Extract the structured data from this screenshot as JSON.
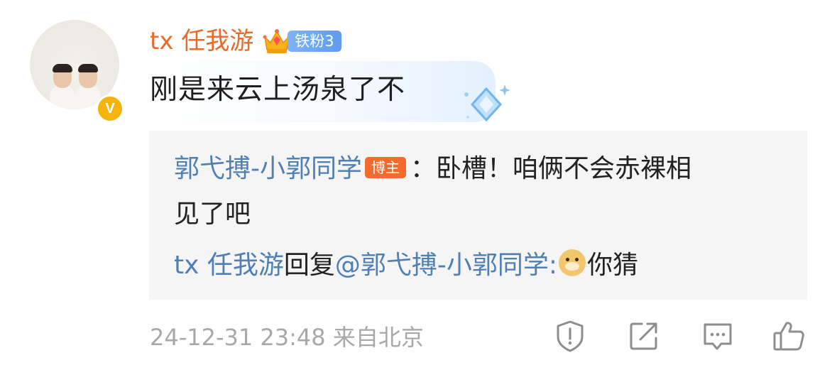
{
  "comment": {
    "username": "tx 任我游",
    "fan_badge": "铁粉3",
    "text": "刚是来云上汤泉了不"
  },
  "reply": {
    "author": "郭弋搏-小郭同学",
    "author_badge": "博主",
    "colon": "：",
    "text_line1": "卧槽！咱俩不会赤裸相",
    "text_line2": "见了吧",
    "reply_user": "tx 任我游",
    "reply_word": "回复",
    "mention": "@郭弋搏-小郭同学",
    "mention_colon": ":",
    "reply_emoji": "doge-emoji",
    "reply_text": "你猜"
  },
  "meta": {
    "date": "24-12-31 23:48",
    "location": "来自北京"
  },
  "actions": [
    "report-icon",
    "share-icon",
    "comment-icon",
    "like-icon"
  ],
  "colors": {
    "username": "#e76b2a",
    "link": "#4f7fb3",
    "host_badge": "#f26a2e",
    "fan_badge": "#6aa3f2",
    "verified": "#f5b40b",
    "meta": "#a8a8a8"
  }
}
